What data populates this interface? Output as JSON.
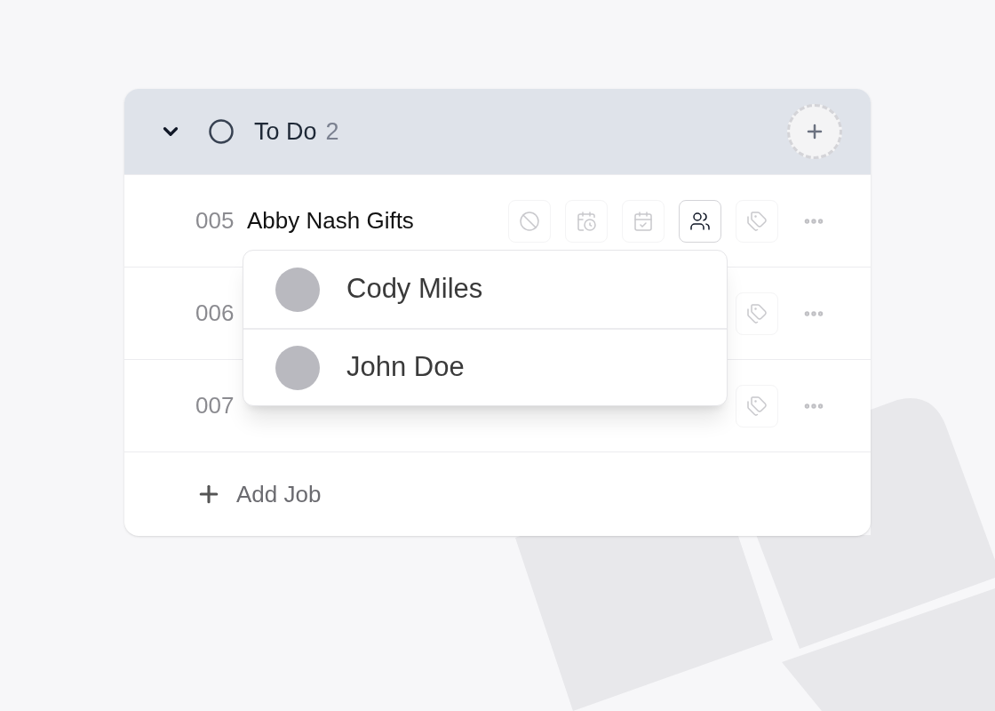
{
  "group": {
    "title": "To Do",
    "count": "2",
    "expanded": true
  },
  "jobs": [
    {
      "number": "005",
      "name": "Abby Nash Gifts",
      "people_open": true
    },
    {
      "number": "006",
      "people_open": false
    },
    {
      "number": "007",
      "people_open": false
    }
  ],
  "people_menu": [
    {
      "name": "Cody Miles"
    },
    {
      "name": "John Doe"
    }
  ],
  "add_job": "Add Job"
}
